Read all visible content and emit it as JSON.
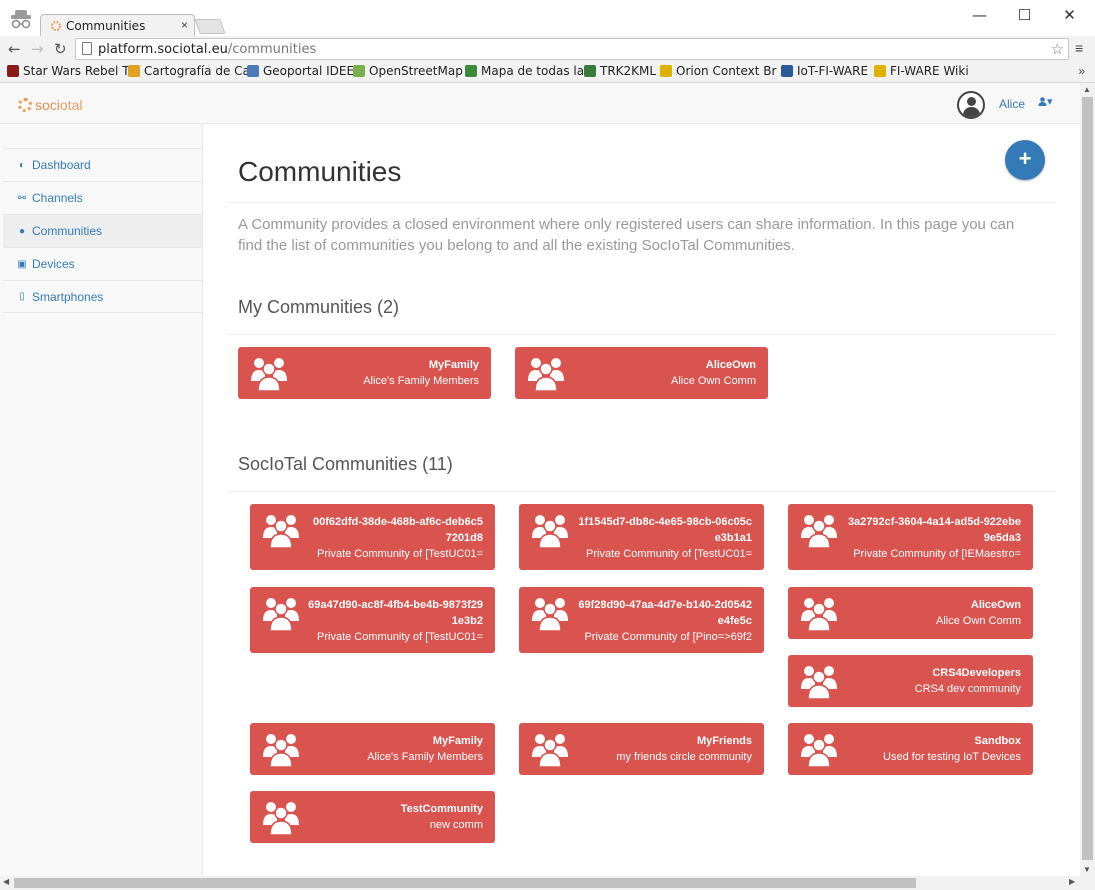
{
  "browser": {
    "tab_title": "Communities",
    "tab_close": "×",
    "url_host": "platform.sociotal.eu",
    "url_path": "/communities",
    "window_buttons": {
      "minimize": "—",
      "maximize": "☐",
      "close": "✕"
    },
    "bookmarks": [
      {
        "label": "Star Wars Rebel T",
        "fade": "",
        "icon": "star-wars-icon",
        "color": "#8b1a1a"
      },
      {
        "label": "Cartografía de Ca",
        "fade": "",
        "icon": "layers-icon",
        "color": "#e0a020"
      },
      {
        "label": "Geoportal IDEE",
        "fade": "",
        "icon": "map-icon",
        "color": "#4a7ab8"
      },
      {
        "label": "OpenStreetMap",
        "fade": "",
        "icon": "osm-icon",
        "color": "#7ab04a"
      },
      {
        "label": "Mapa de todas la",
        "fade": "",
        "icon": "tree-icon",
        "color": "#3a8a3a"
      },
      {
        "label": "TRK2KML",
        "fade": "",
        "icon": "g-icon",
        "color": "#3a7a3a"
      },
      {
        "label": "Orion Context Br",
        "fade": "",
        "icon": "orion-icon",
        "color": "#e0b000"
      },
      {
        "label": "IoT-FI-WARE",
        "fade": "",
        "icon": "eye-icon",
        "color": "#2a5a9a"
      },
      {
        "label": "FI-WARE Wiki",
        "fade": "",
        "icon": "fiware-icon",
        "color": "#e0b000"
      }
    ],
    "bookmarks_more": "»"
  },
  "header": {
    "logo_part1": "soci",
    "logo_part2": "otal",
    "username": "Alice",
    "user_menu": "▾"
  },
  "sidebar": {
    "items": [
      {
        "label": "Dashboard",
        "icon": "dashboard-icon",
        "glyph": "◐"
      },
      {
        "label": "Channels",
        "icon": "link-icon",
        "glyph": "⚯"
      },
      {
        "label": "Communities",
        "icon": "users-icon",
        "glyph": "●"
      },
      {
        "label": "Devices",
        "icon": "device-icon",
        "glyph": "▣"
      },
      {
        "label": "Smartphones",
        "icon": "mobile-icon",
        "glyph": "▯"
      }
    ],
    "active_index": 2
  },
  "main": {
    "title": "Communities",
    "add_label": "+",
    "description": "A Community provides a closed environment where only registered users can share information. In this page you can find the list of communities you belong to and all the existing SocIoTal Communities.",
    "my_section_title": "My Communities (2)",
    "all_section_title": "SocIoTal Communities (11)",
    "my_communities": [
      {
        "name": "MyFamily",
        "desc": "Alice's Family Members"
      },
      {
        "name": "AliceOwn",
        "desc": "Alice Own Comm"
      }
    ],
    "all_communities": [
      {
        "name": "00f62dfd-38de-468b-af6c-deb6c57201d8",
        "desc": "Private Community of [TestUC01="
      },
      {
        "name": "1f1545d7-db8c-4e65-98cb-06c05ce3b1a1",
        "desc": "Private Community of [TestUC01="
      },
      {
        "name": "3a2792cf-3604-4a14-ad5d-922ebe9e5da3",
        "desc": "Private Community of [IEMaestro="
      },
      {
        "name": "69a47d90-ac8f-4fb4-be4b-9873f291e3b2",
        "desc": "Private Community of [TestUC01="
      },
      {
        "name": "69f28d90-47aa-4d7e-b140-2d0542e4fe5c",
        "desc": "Private Community of [Pino=>69f2"
      },
      {
        "name": "AliceOwn",
        "desc": "Alice Own Comm"
      },
      {
        "name": "CRS4Developers",
        "desc": "CRS4 dev community"
      },
      {
        "name": "MyFamily",
        "desc": "Alice's Family Members"
      },
      {
        "name": "MyFriends",
        "desc": "my friends circle community"
      },
      {
        "name": "Sandbox",
        "desc": "Used for testing IoT Devices"
      },
      {
        "name": "TestCommunity",
        "desc": "new comm"
      }
    ]
  },
  "colors": {
    "card": "#d9534f",
    "link": "#337ab7",
    "add_button": "#337ab7"
  }
}
